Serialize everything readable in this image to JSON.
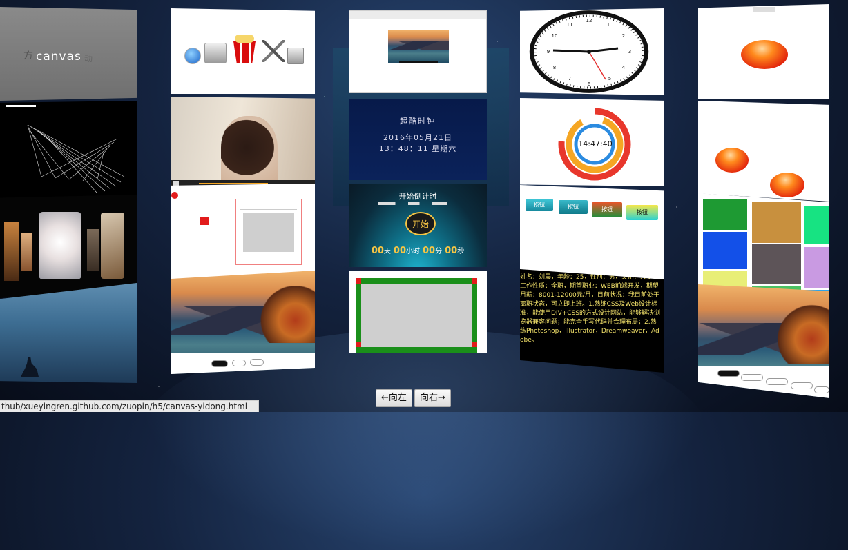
{
  "page": {
    "status_url": "thub/xueyingren.github.com/zuopin/h5/canvas-yidong.html"
  },
  "nav": {
    "left_label": "←向左",
    "right_label": "向右→"
  },
  "cards": {
    "canvas_title": "canvas",
    "canvas_ghost_left": "方",
    "canvas_ghost_right": "动",
    "clock_numbers": [
      "12",
      "1",
      "2",
      "3",
      "4",
      "5",
      "6",
      "7",
      "8",
      "9",
      "10",
      "11"
    ],
    "cool_clock": {
      "title": "超酷时钟",
      "date": "2016年05月21日",
      "time": "13：48：11 星期六"
    },
    "countdown": {
      "title": "开始倒计时",
      "start_label": "开始",
      "days": "00",
      "days_unit": "天",
      "hours": "00",
      "hours_unit": "小时",
      "minutes": "00",
      "minutes_unit": "分",
      "seconds": "00",
      "seconds_unit": "秒"
    },
    "ring_clock_time": "14:47:40",
    "css_buttons": [
      "按钮",
      "按钮",
      "按钮",
      "按钮"
    ],
    "resume_text": "姓名：刘晨，年龄：25，性别：男，文化：大专，工作性质：全职，期望职业：WEB前端开发，期望月薪：8001-12000元/月，目前状况：我目前处于离职状态，可立即上班。1.熟练CSS及Web设计标准，能使用DIV+CSS的方式设计网站，能够解决浏览器兼容问题；能完全手写代码并合理布局；2.熟练Photoshop，Illustrator，Dreamweaver，Adobe。"
  },
  "colors": {
    "accent_orange": "#f5a623",
    "countdown_digits": "#f6c544",
    "clock_second_hand": "#e53030",
    "frame_green": "#1a8f1a",
    "frame_red": "#e21c1c"
  },
  "icons": [
    "safari-icon",
    "finder-icon",
    "popcorn-icon",
    "tools-icon",
    "preview-icon"
  ]
}
